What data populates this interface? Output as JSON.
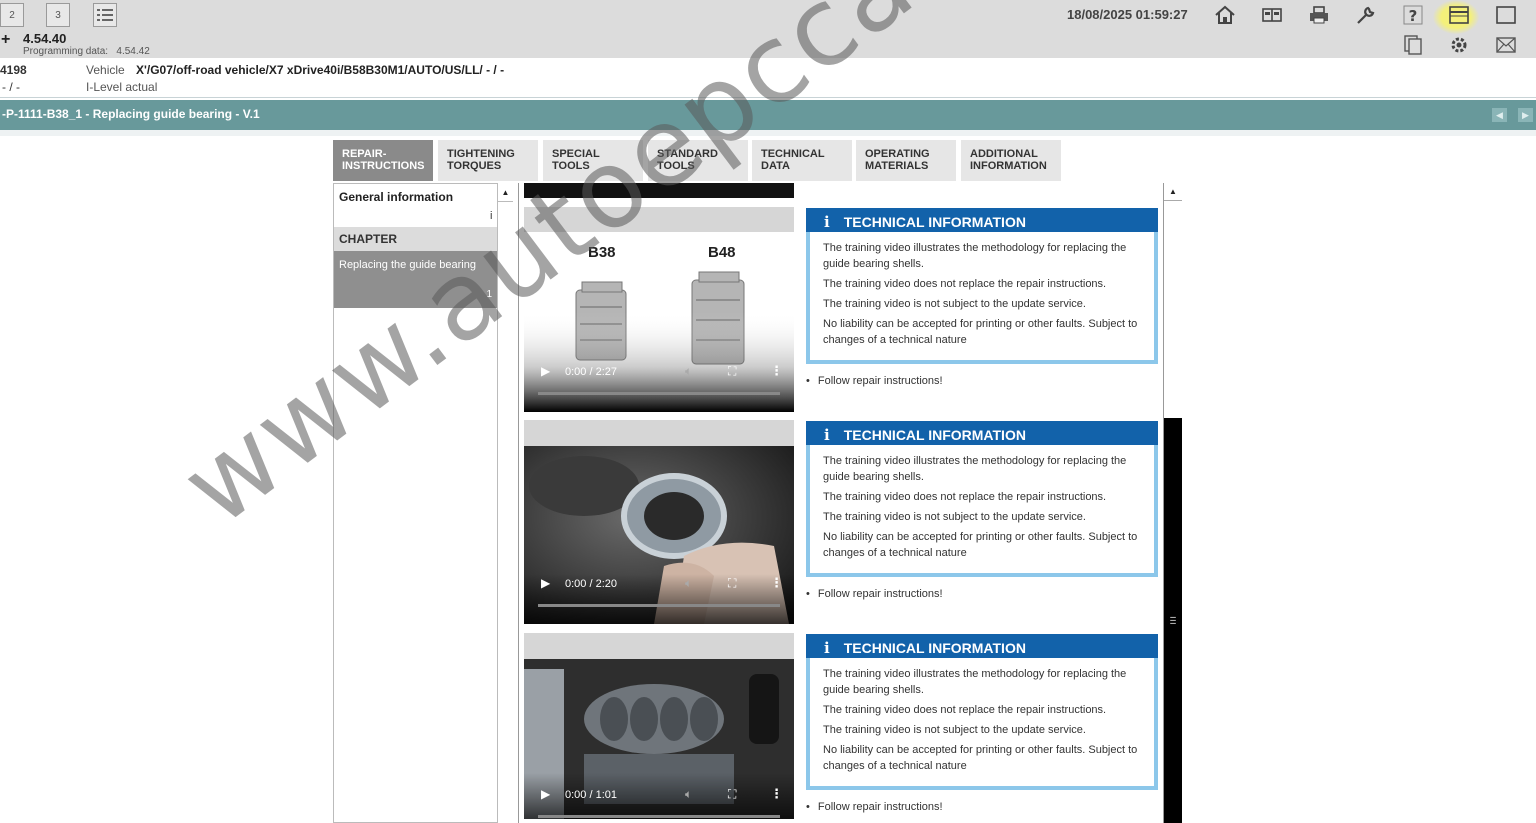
{
  "toolbar": {
    "window_buttons": [
      "2",
      "3"
    ],
    "datetime": "18/08/2025 01:59:27",
    "version": "4.54.40",
    "programming_data_label": "Programming data:",
    "programming_data_value": "4.54.42"
  },
  "vehicle": {
    "id_partial": "4198",
    "dashes": "- / -",
    "label": "Vehicle",
    "value": "X'/G07/off-road vehicle/X7 xDrive40i/B58B30M1/AUTO/US/LL/ - / -",
    "ilevel": "I-Level actual"
  },
  "document": {
    "title": "-P-1111-B38_1 - Replacing guide bearing - V.1"
  },
  "tabs": [
    {
      "label": "REPAIR-\nINSTRUCTIONS",
      "active": true
    },
    {
      "label": "TIGHTENING\nTORQUES",
      "active": false
    },
    {
      "label": "SPECIAL TOOLS",
      "active": false
    },
    {
      "label": "STANDARD\nTOOLS",
      "active": false
    },
    {
      "label": "TECHNICAL\nDATA",
      "active": false
    },
    {
      "label": "OPERATING\nMATERIALS",
      "active": false
    },
    {
      "label": "ADDITIONAL\nINFORMATION",
      "active": false
    }
  ],
  "left_panel": {
    "general": "General information",
    "general_marker": "i",
    "chapter": "CHAPTER",
    "item_label": "Replacing the guide bearing",
    "item_count": "1"
  },
  "videos": [
    {
      "time": "0:00 / 2:27",
      "labels": [
        "B38",
        "B48"
      ]
    },
    {
      "time": "0:00 / 2:20"
    },
    {
      "time": "0:00 / 1:01"
    }
  ],
  "tech_info": {
    "heading": "TECHNICAL INFORMATION",
    "lines": [
      "The training video illustrates the methodology for replacing the guide bearing shells.",
      "The training video does not replace the repair instructions.",
      "The training video is not subject to the update service.",
      "No liability can be accepted for printing or other faults. Subject to changes of a technical nature"
    ],
    "follow": "Follow repair instructions!"
  },
  "watermark": "www.autoepccatalog.com",
  "colors": {
    "titlebar": "#68999b",
    "info_header": "#1262aa",
    "info_border": "#8cc7ea",
    "active_tab": "#8a8a8a"
  }
}
